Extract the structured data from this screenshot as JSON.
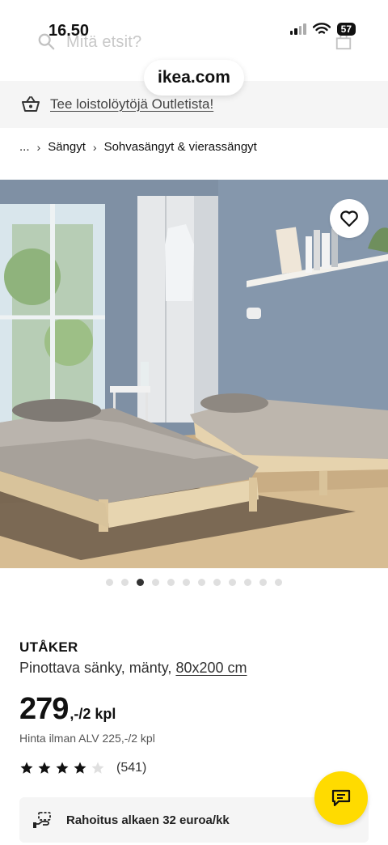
{
  "status_bar": {
    "time": "16.50",
    "battery": "57"
  },
  "search": {
    "placeholder": "Mitä etsit?"
  },
  "browser": {
    "url": "ikea.com"
  },
  "outlet_banner": {
    "text": "Tee loistolöytöjä Outletista!"
  },
  "breadcrumb": {
    "ellipsis": "...",
    "items": [
      "Sängyt",
      "Sohvasängyt & vierassängyt"
    ]
  },
  "carousel": {
    "total": 12,
    "active_index": 2
  },
  "product": {
    "name": "UTÅKER",
    "description": "Pinottava sänky, mänty,",
    "size": "80x200 cm",
    "price": "279",
    "price_unit": ",-/2 kpl",
    "price_vat": "Hinta ilman ALV 225,-/2 kpl",
    "rating": 4,
    "rating_max": 5,
    "review_count": "(541)"
  },
  "financing": {
    "text": "Rahoitus alkaen 32 euroa/kk"
  },
  "colors": {
    "chat_button": "#ffdb00",
    "text": "#111111",
    "banner_bg": "#f5f5f5"
  }
}
